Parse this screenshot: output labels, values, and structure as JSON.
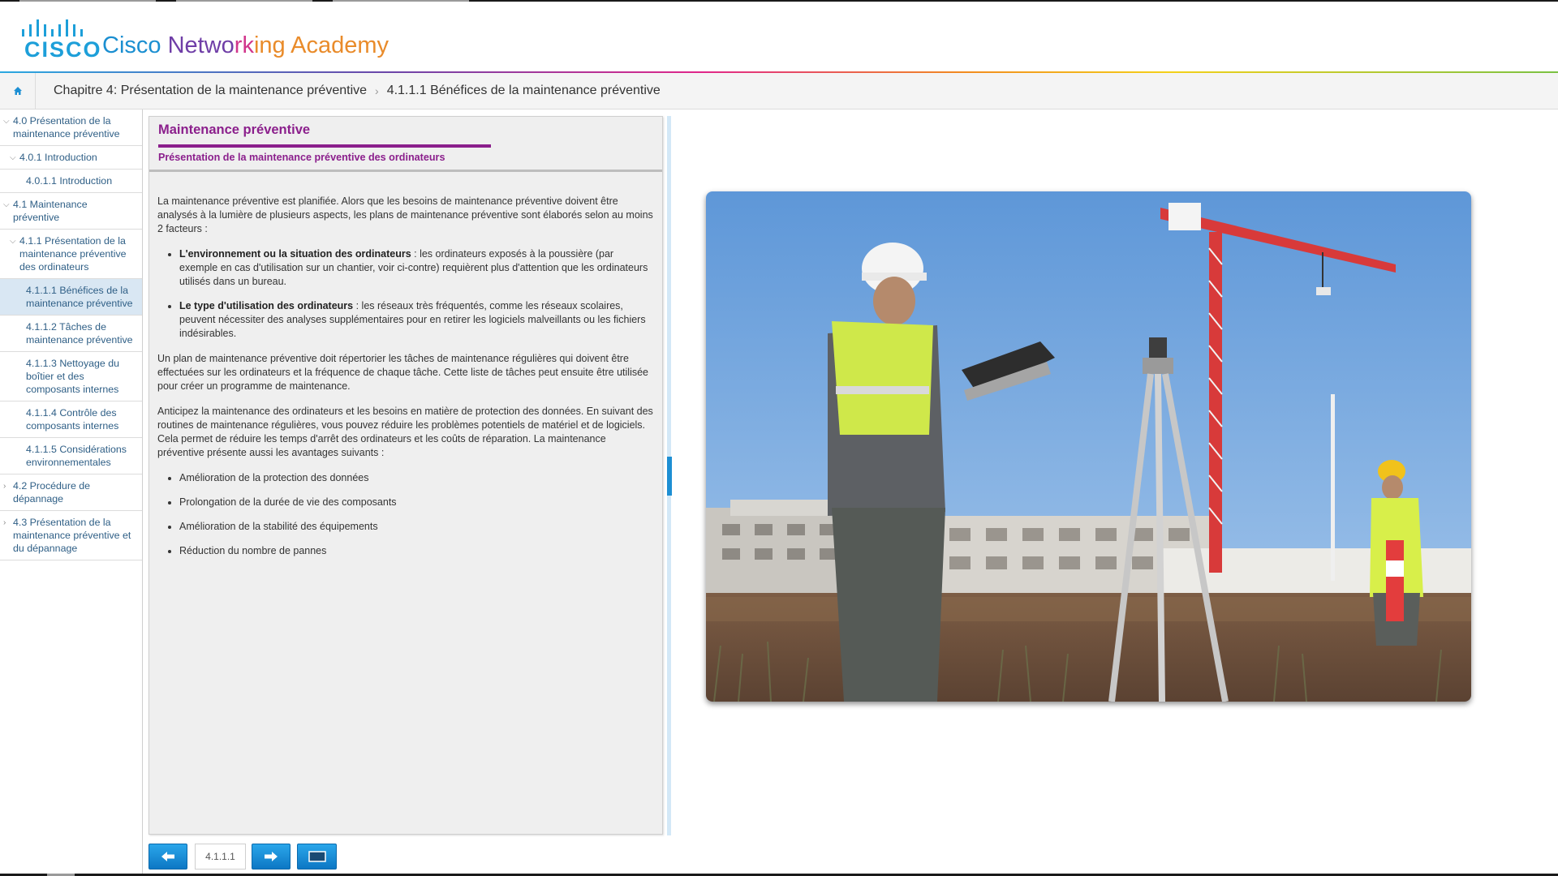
{
  "header": {
    "logo_wordmark": "CISCO",
    "academy_title_parts": [
      "Cisco ",
      "Netwo",
      "rk",
      "ing ",
      "Academy"
    ],
    "brand_colors": {
      "blue": "#1b8fd1",
      "purple": "#6f3ea7",
      "magenta": "#d1368c",
      "orange": "#e98b2a"
    }
  },
  "breadcrumb": {
    "home_icon": "home-icon",
    "chapter": "Chapitre 4: Présentation de la maintenance préventive",
    "separator": "›",
    "page": "4.1.1.1 Bénéfices de la maintenance préventive"
  },
  "sidebar": {
    "items": [
      {
        "label": "4.0 Présentation de la maintenance préventive",
        "chevron": "⌵"
      },
      {
        "label": "4.0.1 Introduction",
        "chevron": "⌵"
      },
      {
        "label": "4.0.1.1 Introduction"
      },
      {
        "label": "4.1 Maintenance préventive",
        "chevron": "⌵"
      },
      {
        "label": "4.1.1 Présentation de la maintenance préventive des ordinateurs",
        "chevron": "⌵"
      },
      {
        "label": "4.1.1.1 Bénéfices de la maintenance préventive"
      },
      {
        "label": "4.1.1.2 Tâches de maintenance préventive"
      },
      {
        "label": "4.1.1.3 Nettoyage du boîtier et des composants internes"
      },
      {
        "label": "4.1.1.4 Contrôle des composants internes"
      },
      {
        "label": "4.1.1.5 Considérations environnementales"
      },
      {
        "label": "4.2 Procédure de dépannage",
        "chevron": "›"
      },
      {
        "label": "4.3 Présentation de la maintenance préventive et du dépannage",
        "chevron": "›"
      }
    ]
  },
  "content": {
    "title": "Maintenance préventive",
    "subtitle": "Présentation de la maintenance préventive des ordinateurs",
    "intro": "La maintenance préventive est planifiée. Alors que les besoins de maintenance préventive doivent être analysés à la lumière de plusieurs aspects, les plans de maintenance préventive sont élaborés selon au moins 2 facteurs :",
    "factors": [
      {
        "term": "L'environnement ou la situation des ordinateurs",
        "text": " : les ordinateurs exposés à la poussière (par exemple en cas d'utilisation sur un chantier, voir ci-contre) requièrent plus d'attention que les ordinateurs utilisés dans un bureau."
      },
      {
        "term": "Le type d'utilisation des ordinateurs",
        "text": " : les réseaux très fréquentés, comme les réseaux scolaires, peuvent nécessiter des analyses supplémentaires pour en retirer les logiciels malveillants ou les fichiers indésirables."
      }
    ],
    "para2": "Un plan de maintenance préventive doit répertorier les tâches de maintenance régulières qui doivent être effectuées sur les ordinateurs et la fréquence de chaque tâche. Cette liste de tâches peut ensuite être utilisée pour créer un programme de maintenance.",
    "para3": "Anticipez la maintenance des ordinateurs et les besoins en matière de protection des données. En suivant des routines de maintenance régulières, vous pouvez réduire les problèmes potentiels de matériel et de logiciels. Cela permet de réduire les temps d'arrêt des ordinateurs et les coûts de réparation. La maintenance préventive présente aussi les avantages suivants :",
    "benefits": [
      "Amélioration de la protection des données",
      "Prolongation de la durée de vie des composants",
      "Amélioration de la stabilité des équipements",
      "Réduction du nombre de pannes"
    ]
  },
  "controls": {
    "prev_icon": "arrow-left-icon",
    "page_number": "4.1.1.1",
    "next_icon": "arrow-right-icon",
    "fullscreen_icon": "screen-icon"
  }
}
